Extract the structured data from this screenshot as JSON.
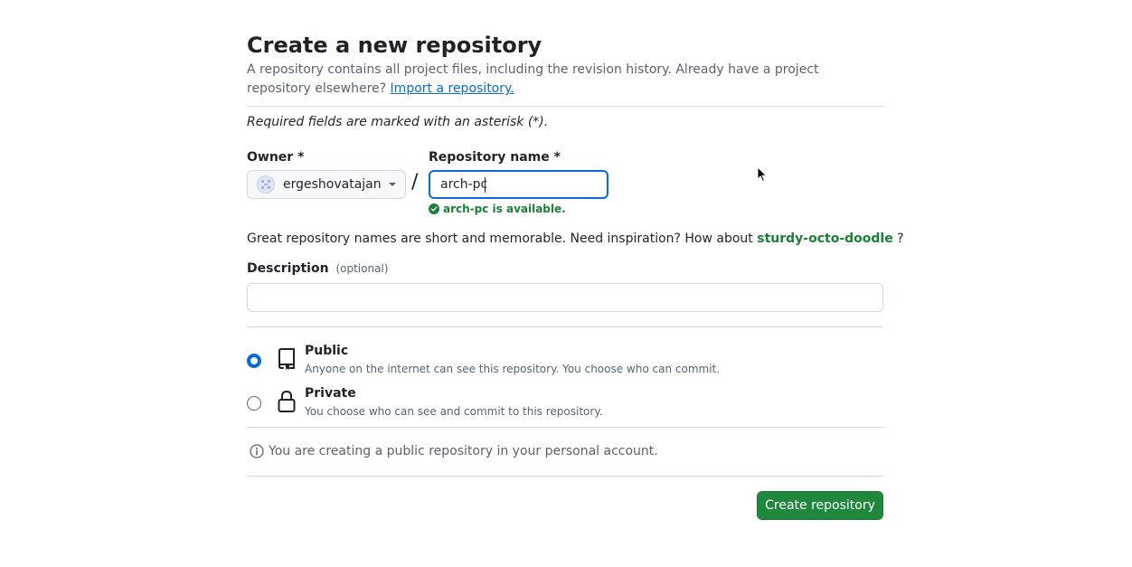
{
  "header": {
    "title": "Create a new repository",
    "subtitle_text": "A repository contains all project files, including the revision history. Already have a project repository elsewhere?",
    "import_link": "Import a repository."
  },
  "form": {
    "required_note": "Required fields are marked with an asterisk (*).",
    "owner_label": "Owner *",
    "owner_value": "ergeshovatajan",
    "separator": "/",
    "repo_name_label": "Repository name *",
    "repo_name_value": "arch-pc",
    "availability": "arch-pc is available.",
    "inspiration_text": "Great repository names are short and memorable. Need inspiration? How about",
    "suggestion": "sturdy-octo-doodle",
    "inspiration_suffix": "?",
    "description_label": "Description",
    "description_optional": "(optional)",
    "description_value": ""
  },
  "visibility": {
    "options": [
      {
        "label": "Public",
        "description": "Anyone on the internet can see this repository. You choose who can commit.",
        "checked": true,
        "icon": "repo-icon"
      },
      {
        "label": "Private",
        "description": "You choose who can see and commit to this repository.",
        "checked": false,
        "icon": "lock-icon"
      }
    ]
  },
  "info": {
    "text": "You are creating a public repository in your personal account.",
    "icon": "info-icon"
  },
  "actions": {
    "create_label": "Create repository"
  },
  "colors": {
    "link": "#0969da",
    "success": "#1a7f37",
    "primary_button": "#1f883d",
    "focus_border": "#0969da"
  }
}
